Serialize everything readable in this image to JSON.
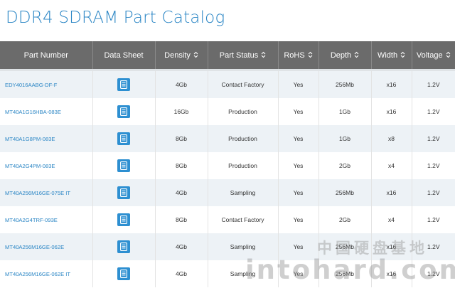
{
  "page": {
    "title": "DDR4 SDRAM Part Catalog"
  },
  "table": {
    "columns": [
      {
        "label": "Part Number",
        "sortable": false
      },
      {
        "label": "Data Sheet",
        "sortable": false
      },
      {
        "label": "Density",
        "sortable": true
      },
      {
        "label": "Part Status",
        "sortable": true
      },
      {
        "label": "RoHS",
        "sortable": true
      },
      {
        "label": "Depth",
        "sortable": true
      },
      {
        "label": "Width",
        "sortable": true
      },
      {
        "label": "Voltage",
        "sortable": true
      }
    ],
    "rows": [
      {
        "part": "EDY4016AABG-DF-F",
        "density": "4Gb",
        "status": "Contact Factory",
        "rohs": "Yes",
        "depth": "256Mb",
        "width": "x16",
        "voltage": "1.2V"
      },
      {
        "part": "MT40A1G16HBA-083E",
        "density": "16Gb",
        "status": "Production",
        "rohs": "Yes",
        "depth": "1Gb",
        "width": "x16",
        "voltage": "1.2V"
      },
      {
        "part": "MT40A1G8PM-083E",
        "density": "8Gb",
        "status": "Production",
        "rohs": "Yes",
        "depth": "1Gb",
        "width": "x8",
        "voltage": "1.2V"
      },
      {
        "part": "MT40A2G4PM-083E",
        "density": "8Gb",
        "status": "Production",
        "rohs": "Yes",
        "depth": "2Gb",
        "width": "x4",
        "voltage": "1.2V"
      },
      {
        "part": "MT40A256M16GE-075E IT",
        "density": "4Gb",
        "status": "Sampling",
        "rohs": "Yes",
        "depth": "256Mb",
        "width": "x16",
        "voltage": "1.2V"
      },
      {
        "part": "MT40A2G4TRF-093E",
        "density": "8Gb",
        "status": "Contact Factory",
        "rohs": "Yes",
        "depth": "2Gb",
        "width": "x4",
        "voltage": "1.2V"
      },
      {
        "part": "MT40A256M16GE-062E",
        "density": "4Gb",
        "status": "Sampling",
        "rohs": "Yes",
        "depth": "256Mb",
        "width": "x16",
        "voltage": "1.2V"
      },
      {
        "part": "MT40A256M16GE-062E IT",
        "density": "4Gb",
        "status": "Sampling",
        "rohs": "Yes",
        "depth": "256Mb",
        "width": "x16",
        "voltage": "1.2V"
      }
    ]
  },
  "watermark": {
    "chinese": "中国硬盘基地",
    "latin": "intohard.com"
  },
  "icons": {
    "datasheet": "document-icon",
    "sort": "sort-updown-icon"
  },
  "colors": {
    "accent": "#2b86c5",
    "header_bg": "#6b6b6b",
    "button": "#2d8fd1",
    "row_alt": "#edf2f6"
  }
}
